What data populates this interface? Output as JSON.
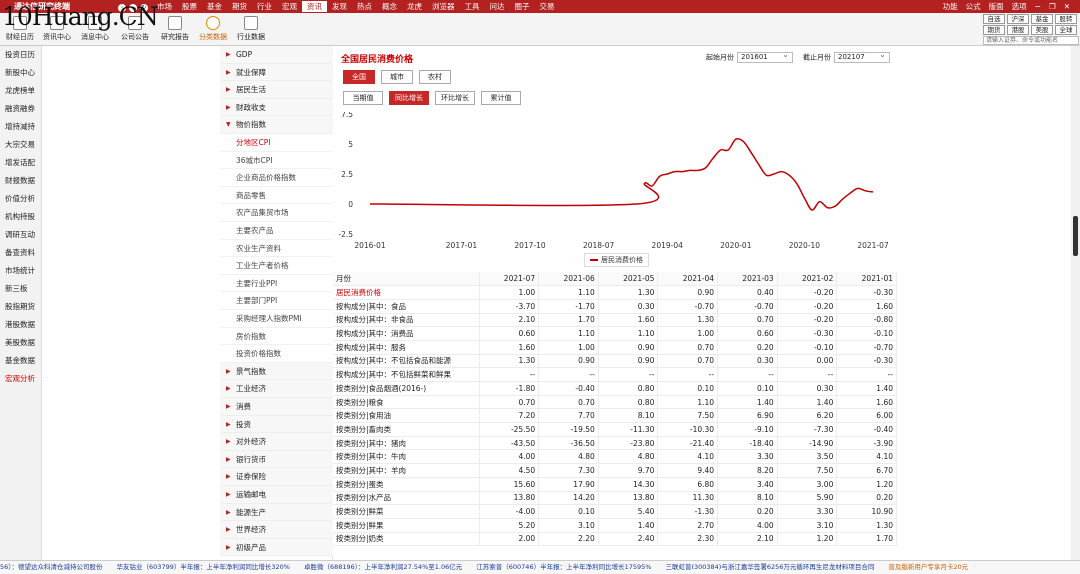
{
  "watermark": "10Huang.CN",
  "app": {
    "name": "通达信研究终端"
  },
  "top_menu": [
    "市场",
    "股票",
    "基金",
    "期货",
    "行业",
    "宏观",
    "资讯",
    "发现",
    "热点",
    "概念",
    "龙虎",
    "浏览器",
    "工具",
    "问达",
    "圈子",
    "交易"
  ],
  "top_menu_active": "资讯",
  "top_right": [
    "功能",
    "公式",
    "版面",
    "选项"
  ],
  "toolbar": [
    {
      "label": "财经日历",
      "icon": "calendar-icon"
    },
    {
      "label": "资讯中心",
      "icon": "news-icon"
    },
    {
      "label": "消息中心",
      "icon": "message-icon"
    },
    {
      "label": "公司公告",
      "icon": "announcement-icon"
    },
    {
      "label": "研究报告",
      "icon": "report-icon"
    },
    {
      "label": "分类数据",
      "icon": "clock-icon"
    },
    {
      "label": "行业数据",
      "icon": "chart-icon"
    }
  ],
  "quick_buttons": [
    "自选",
    "沪深",
    "基金",
    "股转",
    "期货",
    "港股",
    "美股",
    "全球"
  ],
  "command_placeholder": "请输入证券、命令或功能名",
  "left_nav": [
    "投资日历",
    "新股中心",
    "龙虎榜单",
    "融资融券",
    "增持减持",
    "大宗交易",
    "增发话配",
    "财报数据",
    "价值分析",
    "机构持股",
    "调研互动",
    "备查资料",
    "市场统计",
    "新三板",
    "股指期货",
    "港股数据",
    "美股数据",
    "基金数据",
    "宏观分析"
  ],
  "left_nav_active": "宏观分析",
  "tree": {
    "top": [
      "GDP",
      "就业保障",
      "居民生活",
      "财政收支"
    ],
    "open": "物价指数",
    "sub": [
      "分地区CPI",
      "36城市CPI",
      "企业商品价格指数",
      "商品零售",
      "农产品集贸市场",
      "主要农产品",
      "农业生产资料",
      "工业生产者价格",
      "主要行业PPI",
      "主要部门PPI",
      "采购经理人指数PMI",
      "房价指数",
      "投资价格指数"
    ],
    "sub_active": "分地区CPI",
    "bottom": [
      "景气指数",
      "工业经济",
      "消费",
      "投资",
      "对外经济",
      "银行货币",
      "证券保险",
      "运输邮电",
      "能源生产",
      "世界经济",
      "初级产品"
    ]
  },
  "panel": {
    "title": "全国居民消费价格",
    "start_label": "起始月份",
    "start_value": "201601",
    "end_label": "截止月份",
    "end_value": "202107",
    "region_tabs": [
      "全国",
      "城市",
      "农村"
    ],
    "region_active": "全国",
    "metric_tabs": [
      "当期值",
      "同比增长",
      "环比增长",
      "累计值"
    ],
    "metric_active": "同比增长"
  },
  "chart_data": {
    "type": "line",
    "title": "",
    "xlabel": "",
    "ylabel": "",
    "ylim": [
      -2.5,
      7.5
    ],
    "yticks": [
      "7.5",
      "5",
      "2.5",
      "0",
      "-2.5"
    ],
    "xticks": [
      "2016-01",
      "2017-01",
      "2017-10",
      "2018-07",
      "2019-04",
      "2020-01",
      "2020-10",
      "2021-07"
    ],
    "x_months": [
      "2016-01",
      "2018-12",
      "2019-01",
      "2019-02",
      "2019-03",
      "2019-04",
      "2019-05",
      "2019-06",
      "2019-07",
      "2019-08",
      "2019-09",
      "2019-10",
      "2019-11",
      "2019-12",
      "2020-01",
      "2020-02",
      "2020-03",
      "2020-04",
      "2020-05",
      "2020-06",
      "2020-07",
      "2020-08",
      "2020-09",
      "2020-10",
      "2020-11",
      "2020-12",
      "2021-01",
      "2021-02",
      "2021-03",
      "2021-04",
      "2021-05",
      "2021-06",
      "2021-07"
    ],
    "series": [
      {
        "name": "居民消费价格",
        "color": "#c00000",
        "values": [
          0,
          0,
          1.7,
          1.5,
          2.3,
          2.5,
          2.7,
          2.7,
          2.8,
          2.8,
          3.0,
          3.8,
          4.5,
          4.5,
          5.4,
          5.2,
          4.3,
          3.3,
          2.4,
          2.5,
          2.7,
          2.4,
          1.7,
          0.5,
          -0.5,
          0.2,
          -0.3,
          -0.2,
          0.4,
          0.9,
          1.3,
          1.1,
          1.0
        ]
      }
    ],
    "legend": "居民消费价格",
    "grid": false
  },
  "table": {
    "header": [
      "月份",
      "2021-07",
      "2021-06",
      "2021-05",
      "2021-04",
      "2021-03",
      "2021-02",
      "2021-01"
    ],
    "rows": [
      [
        "居民消费价格",
        "1.00",
        "1.10",
        "1.30",
        "0.90",
        "0.40",
        "-0.20",
        "-0.30"
      ],
      [
        "按构成分|其中：食品",
        "-3.70",
        "-1.70",
        "0.30",
        "-0.70",
        "-0.70",
        "-0.20",
        "1.60"
      ],
      [
        "按构成分|其中：非食品",
        "2.10",
        "1.70",
        "1.60",
        "1.30",
        "0.70",
        "-0.20",
        "-0.80"
      ],
      [
        "按构成分|其中：消费品",
        "0.60",
        "1.10",
        "1.10",
        "1.00",
        "0.60",
        "-0.30",
        "-0.10"
      ],
      [
        "按构成分|其中：服务",
        "1.60",
        "1.00",
        "0.90",
        "0.70",
        "0.20",
        "-0.10",
        "-0.70"
      ],
      [
        "按构成分|其中：不包括食品和能源",
        "1.30",
        "0.90",
        "0.90",
        "0.70",
        "0.30",
        "0.00",
        "-0.30"
      ],
      [
        "按构成分|其中：不包括鲜菜和鲜果",
        "--",
        "--",
        "--",
        "--",
        "--",
        "--",
        "--"
      ],
      [
        "按类别分|食品烟酒(2016-)",
        "-1.80",
        "-0.40",
        "0.80",
        "0.10",
        "0.10",
        "0.30",
        "1.40"
      ],
      [
        "按类别分|粮食",
        "0.70",
        "0.70",
        "0.80",
        "1.10",
        "1.40",
        "1.40",
        "1.60"
      ],
      [
        "按类别分|食用油",
        "7.20",
        "7.70",
        "8.10",
        "7.50",
        "6.90",
        "6.20",
        "6.00"
      ],
      [
        "按类别分|畜肉类",
        "-25.50",
        "-19.50",
        "-11.30",
        "-10.30",
        "-9.10",
        "-7.30",
        "-0.40"
      ],
      [
        "按类别分|其中：猪肉",
        "-43.50",
        "-36.50",
        "-23.80",
        "-21.40",
        "-18.40",
        "-14.90",
        "-3.90"
      ],
      [
        "按类别分|其中：牛肉",
        "4.00",
        "4.80",
        "4.80",
        "4.10",
        "3.30",
        "3.50",
        "4.10"
      ],
      [
        "按类别分|其中：羊肉",
        "4.50",
        "7.30",
        "9.70",
        "9.40",
        "8.20",
        "7.50",
        "6.70"
      ],
      [
        "按类别分|蛋类",
        "15.60",
        "17.90",
        "14.30",
        "6.80",
        "3.40",
        "3.00",
        "1.20"
      ],
      [
        "按类别分|水产品",
        "13.80",
        "14.20",
        "13.80",
        "11.30",
        "8.10",
        "5.90",
        "0.20"
      ],
      [
        "按类别分|鲜菜",
        "-4.00",
        "0.10",
        "5.40",
        "-1.30",
        "0.20",
        "3.30",
        "10.90"
      ],
      [
        "按类别分|鲜果",
        "5.20",
        "3.10",
        "1.40",
        "2.70",
        "4.00",
        "3.10",
        "1.30"
      ],
      [
        "按类别分|奶类",
        "2.00",
        "2.20",
        "2.40",
        "2.30",
        "2.10",
        "1.20",
        "1.70"
      ]
    ]
  },
  "ticker": [
    "56）：德望达众科清仓减持公司股份",
    "华友钴业（603799）半年报：上半年净利润同比增长320%",
    "卓胜微（688196）：上半年净利润27.54%至1.06亿元",
    "江苏索普（600746）半年报：上半年净利同比增长17595%",
    "三联虹普(300384)与浙江嘉华签署6256万元循环再生尼龙材料项目合同",
    "普及版新用户专享月卡20元"
  ]
}
